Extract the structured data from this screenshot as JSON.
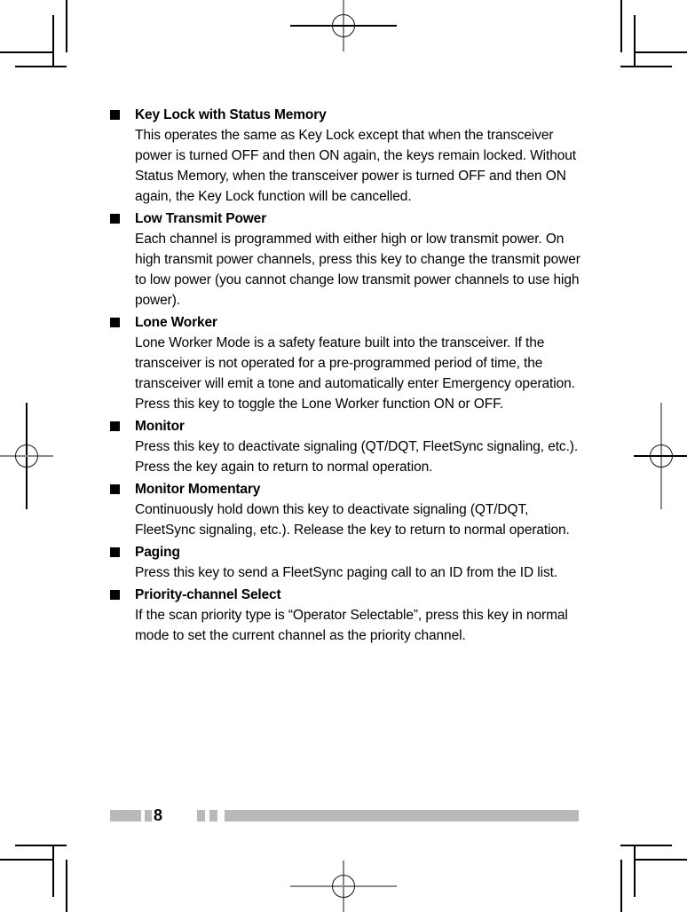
{
  "document": {
    "page_number": "8",
    "sections": [
      {
        "heading": "Key Lock with Status Memory",
        "body": "This operates the same as Key Lock except that when the transceiver power is turned OFF and then ON again, the keys remain locked. Without Status Memory, when the transceiver power is turned OFF and then ON again, the Key Lock function will be cancelled."
      },
      {
        "heading": "Low Transmit Power",
        "body": "Each channel is programmed with either high or low transmit power. On high transmit power channels, press this key to change the transmit power to low power (you cannot change low transmit power channels to use high power)."
      },
      {
        "heading": "Lone Worker",
        "body": "Lone Worker Mode is a safety feature built into the transceiver. If the transceiver is not operated for a pre-programmed period of time, the transceiver will emit a tone and automatically enter Emergency operation.",
        "body2": "Press this key to toggle the Lone Worker function ON or OFF."
      },
      {
        "heading": "Monitor",
        "body": "Press this key to deactivate signaling (QT/DQT, FleetSync signaling, etc.). Press the key again to return to normal operation."
      },
      {
        "heading": "Monitor Momentary",
        "body": "Continuously hold down this key to deactivate signaling (QT/DQT, FleetSync signaling, etc.). Release the key to return to normal operation."
      },
      {
        "heading": "Paging",
        "body": "Press this key to send a FleetSync paging call to an ID from the ID list."
      },
      {
        "heading": "Priority-channel Select",
        "body": "If the scan priority type is “Operator Selectable”, press this key in normal mode to set the current channel as the priority channel."
      }
    ]
  },
  "colors": {
    "text": "#000000",
    "footer_rule": "#b9b9b9",
    "crop_mark": "#000000"
  }
}
